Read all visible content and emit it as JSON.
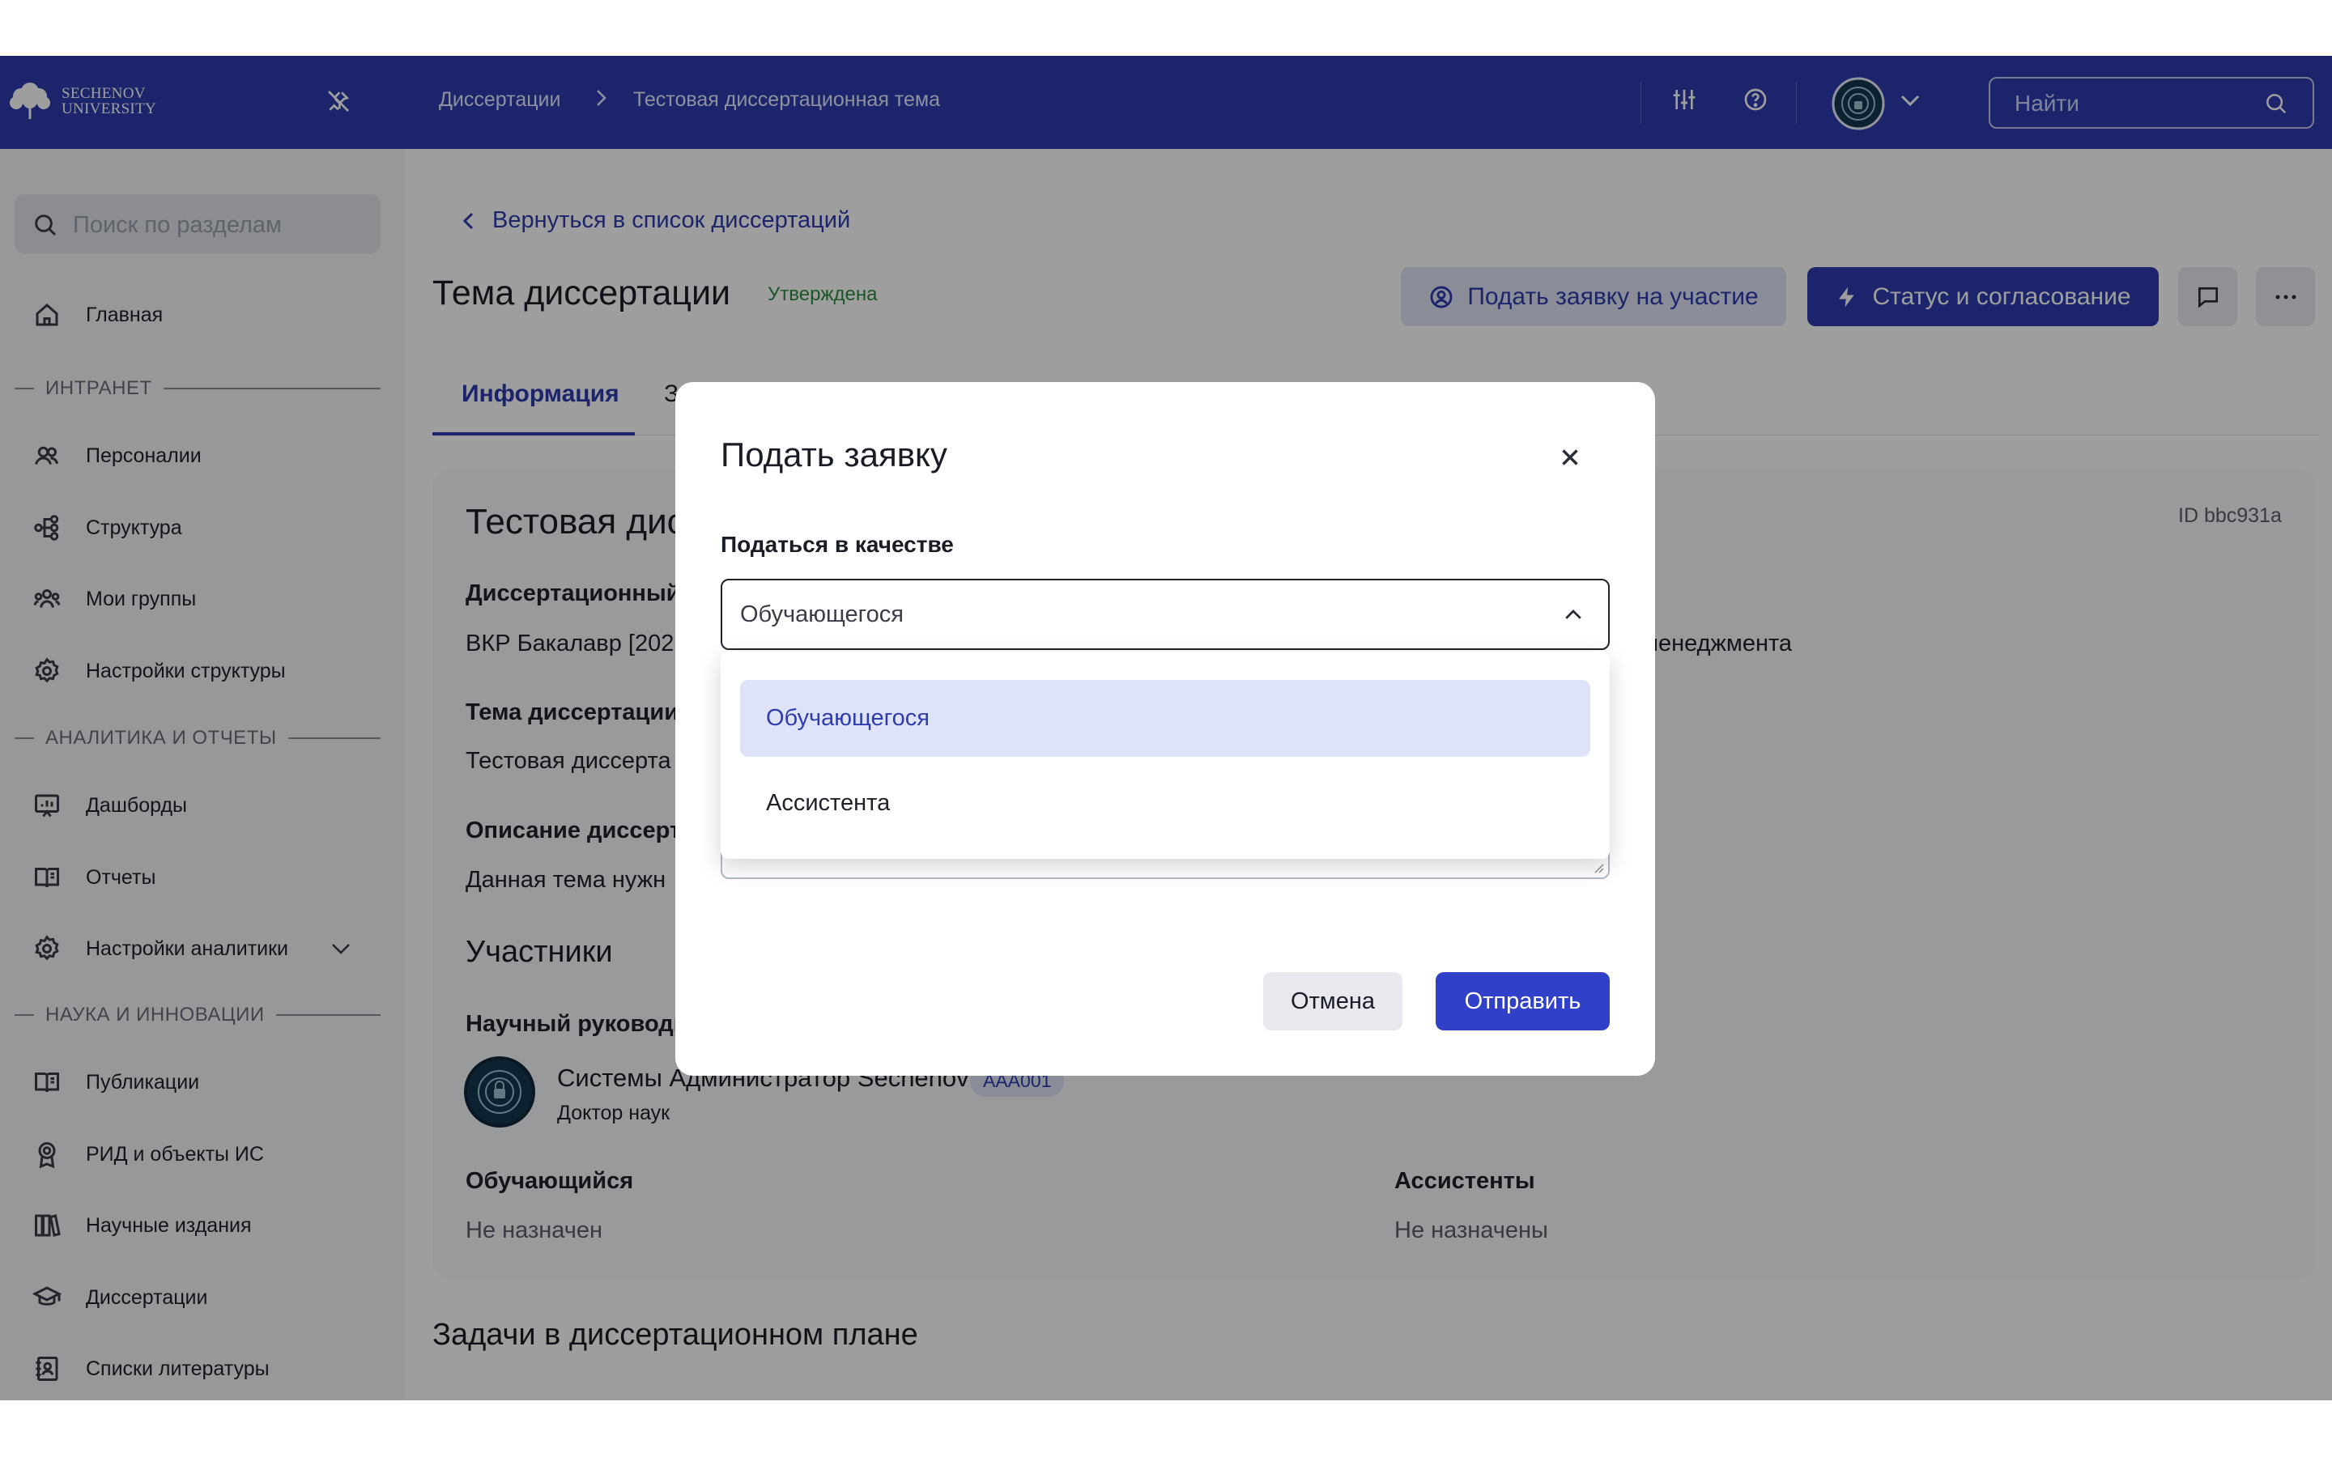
{
  "brand": {
    "logo_line1": "SECHENOV",
    "logo_line2": "UNIVERSITY"
  },
  "header": {
    "breadcrumb": [
      "Диссертации",
      "Тестовая диссертационная тема"
    ],
    "search_placeholder": "Найти"
  },
  "sidebar": {
    "search_placeholder": "Поиск по разделам",
    "home": "Главная",
    "sections": [
      "ИНТРАНЕТ",
      "АНАЛИТИКА И ОТЧЕТЫ",
      "НАУКА И ИННОВАЦИИ"
    ],
    "intranet_items": [
      "Персоналии",
      "Структура",
      "Мои группы",
      "Настройки структуры"
    ],
    "analytics_items": [
      "Дашборды",
      "Отчеты",
      "Настройки аналитики"
    ],
    "science_items": [
      "Публикации",
      "РИД и объекты ИС",
      "Научные издания",
      "Диссертации",
      "Списки литературы"
    ]
  },
  "main": {
    "back_link": "Вернуться в список диссертаций",
    "title": "Тема диссертации",
    "status": "Утверждена",
    "apply_button": "Подать заявку на участие",
    "status_button": "Статус и согласование",
    "tabs": [
      "Информация",
      "З"
    ],
    "card": {
      "heading": "Тестовая дис",
      "id_label": "ID bbc931a",
      "field1_label": "Диссертационный",
      "field1_value": "ВКР Бакалавр [202",
      "field1_right_value": "менеджмента",
      "field2_label": "Тема диссертации",
      "field2_value": "Тестовая диссерта",
      "field3_label": "Описание диссерт",
      "field3_value": "Данная тема нужн",
      "participants_title": "Участники",
      "supervisor_label": "Научный руководи",
      "supervisor_name": "Системы Администратор Sechenov",
      "supervisor_tag": "AAA001",
      "supervisor_degree": "Доктор наук",
      "student_label": "Обучающийся",
      "student_value": "Не назначен",
      "assistants_label": "Ассистенты",
      "assistants_value": "Не назначены"
    },
    "tasks_title": "Задачи в диссертационном плане"
  },
  "modal": {
    "title": "Подать заявку",
    "field_label": "Податься в качестве",
    "selected_value": "Обучающегося",
    "options": [
      "Обучающегося",
      "Ассистента"
    ],
    "cancel": "Отмена",
    "submit": "Отправить"
  },
  "colors": {
    "primary": "#2e3dae",
    "header_bg": "#2e3dae",
    "status_green": "#2e8a3e"
  }
}
